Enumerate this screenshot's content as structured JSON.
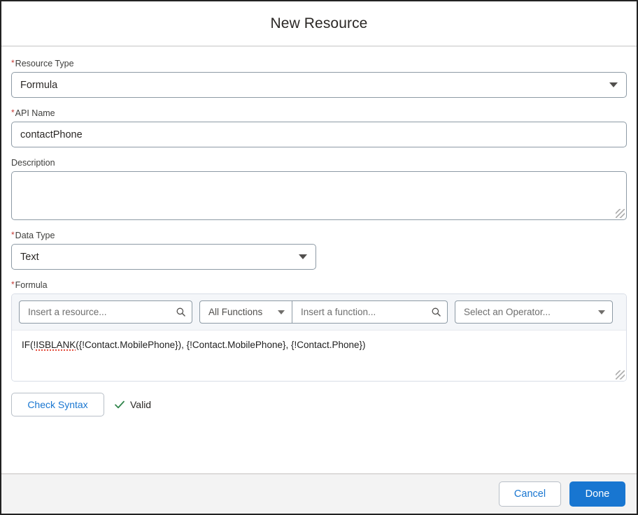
{
  "dialog": {
    "title": "New Resource"
  },
  "fields": {
    "resource_type": {
      "label": "Resource Type",
      "required_marker": "*",
      "value": "Formula",
      "icon": "chevron-down-icon"
    },
    "api_name": {
      "label": "API Name",
      "required_marker": "*",
      "value": "contactPhone"
    },
    "description": {
      "label": "Description",
      "value": "",
      "placeholder": ""
    },
    "data_type": {
      "label": "Data Type",
      "required_marker": "*",
      "value": "Text",
      "icon": "chevron-down-icon"
    },
    "formula": {
      "label": "Formula",
      "required_marker": "*",
      "value_prefix": "IF(!",
      "value_spellchecked": "ISBLANK",
      "value_suffix": "({!Contact.MobilePhone}), {!Contact.MobilePhone}, {!Contact.Phone})",
      "full_value": "IF(!ISBLANK({!Contact.MobilePhone}), {!Contact.MobilePhone}, {!Contact.Phone})"
    }
  },
  "formula_toolbar": {
    "resource_placeholder": "Insert a resource...",
    "resource_icon": "search-icon",
    "all_functions_label": "All Functions",
    "all_functions_icon": "chevron-down-icon",
    "function_placeholder": "Insert a function...",
    "function_icon": "search-icon",
    "operator_label": "Select an Operator...",
    "operator_icon": "chevron-down-icon"
  },
  "syntax": {
    "check_button_label": "Check Syntax",
    "status_label": "Valid",
    "status_icon": "check-icon",
    "status_color": "#2e844a"
  },
  "footer": {
    "cancel_label": "Cancel",
    "done_label": "Done"
  },
  "colors": {
    "accent_blue": "#1876d1",
    "required_red": "#c23934",
    "valid_green": "#2e844a",
    "footer_bg": "#f3f3f3",
    "toolbar_bg": "#f4f6f9"
  }
}
